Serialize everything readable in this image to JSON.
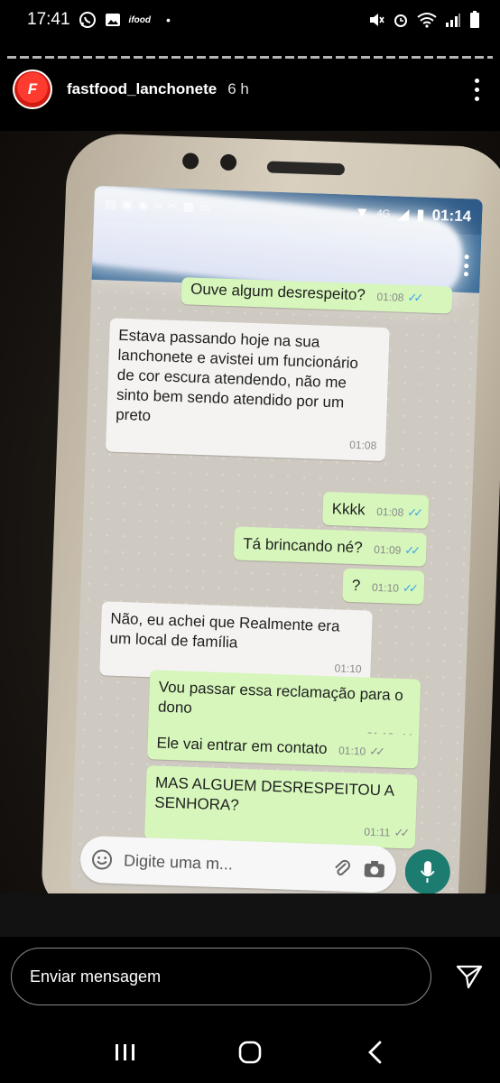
{
  "status_bar": {
    "time": "17:41",
    "left_icons": [
      "whatsapp-icon",
      "gallery-icon",
      "ifood-icon"
    ],
    "dot": "•",
    "ifood_label": "ifood",
    "right_icons": [
      "mute-icon",
      "alarm-icon",
      "wifi-icon",
      "signal-icon",
      "battery-icon"
    ]
  },
  "story": {
    "username": "fastfood_lanchonete",
    "time_ago": "6 h",
    "avatar_text": "F"
  },
  "phone": {
    "status_time": "01:14",
    "network": "4G",
    "messages": [
      {
        "dir": "out",
        "text": "Ouve algum desrespeito?",
        "time": "01:08"
      },
      {
        "dir": "in",
        "text": "Estava passando hoje na sua lanchonete e avistei um funcionário de cor escura atendendo, não me sinto bem sendo atendido por um preto",
        "time": "01:08"
      },
      {
        "dir": "out",
        "text": "Kkkk",
        "time": "01:08"
      },
      {
        "dir": "out",
        "text": "Tá brincando né?",
        "time": "01:09"
      },
      {
        "dir": "out",
        "text": "?",
        "time": "01:10"
      },
      {
        "dir": "in",
        "text": "Não, eu achei que Realmente era um local de família",
        "time": "01:10"
      },
      {
        "dir": "out",
        "text": "Vou passar essa reclamação para o dono",
        "time": "01:10"
      },
      {
        "dir": "out",
        "text": "Ele vai entrar em contato",
        "time": "01:10"
      },
      {
        "dir": "out",
        "text": "MAS ALGUEM DESRESPEITOU A SENHORA?",
        "time": "01:11"
      }
    ],
    "input_placeholder": "Digite uma m..."
  },
  "reply": {
    "placeholder": "Enviar mensagem"
  },
  "colors": {
    "wa_header": "#3a6b97",
    "out_bubble": "#d6f6bb",
    "in_bubble": "#f4f3f1",
    "brand_red": "#ff3b30"
  }
}
